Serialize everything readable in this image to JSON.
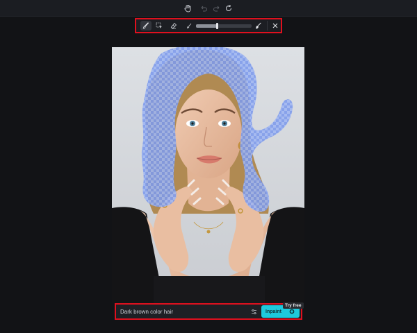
{
  "topbar": {
    "icons": [
      "hand-icon",
      "undo-icon",
      "redo-icon",
      "reset-icon"
    ]
  },
  "tools": {
    "items": [
      {
        "name": "brush-icon",
        "active": true
      },
      {
        "name": "smart-select-icon",
        "active": false
      },
      {
        "name": "eraser-icon",
        "active": false
      },
      {
        "name": "brush-size-small-icon",
        "active": false
      },
      {
        "name": "brush-size-large-icon",
        "active": false
      },
      {
        "name": "close-icon",
        "active": false
      }
    ],
    "brush_size_fraction": 0.38
  },
  "prompt": {
    "value": "Dark brown color hair",
    "inpaint_label": "Inpaint",
    "badge": "Try free"
  },
  "colors": {
    "accent": "#1ec9dc",
    "highlight_border": "#e0101e",
    "mask": "#6f8fe8"
  }
}
